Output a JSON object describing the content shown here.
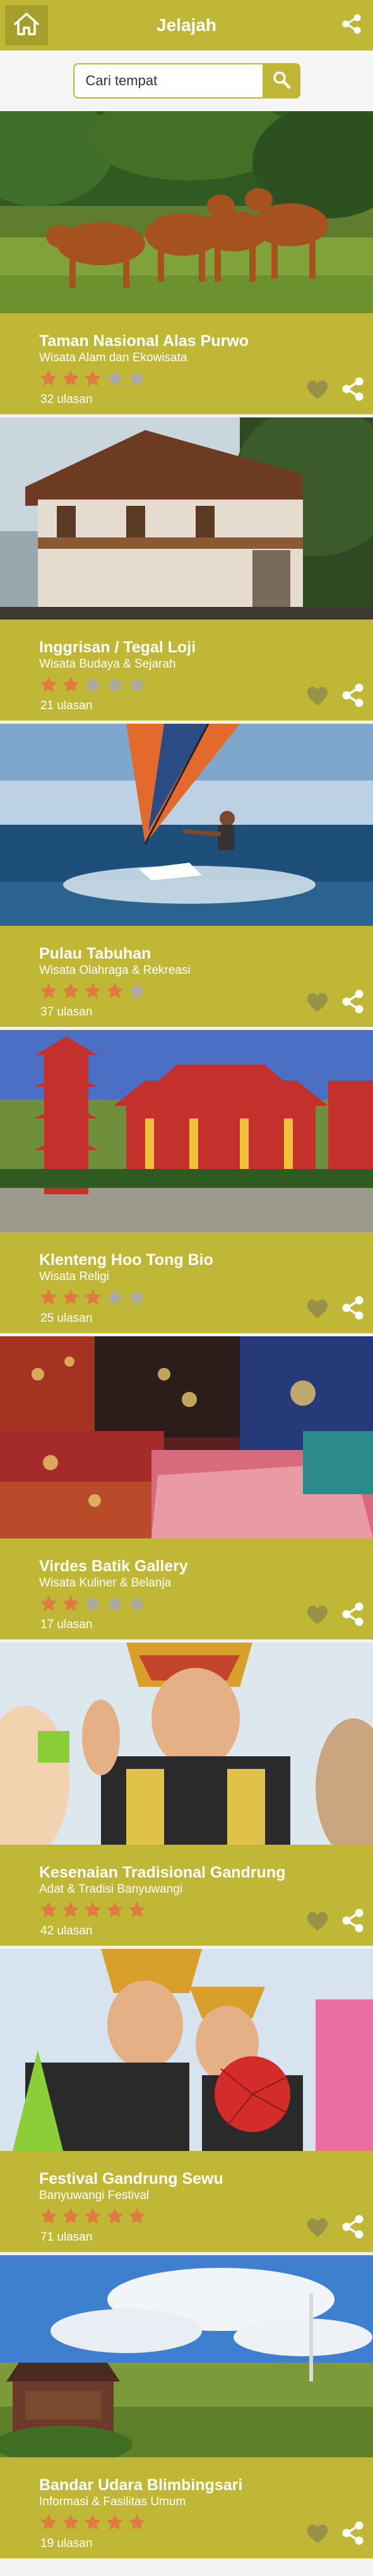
{
  "header": {
    "title": "Jelajah"
  },
  "search": {
    "placeholder": "Cari tempat"
  },
  "colors": {
    "accent": "#c1b736",
    "star_on": "#e07a3f",
    "star_off": "#a9a9a9",
    "icon": "#ffffff"
  },
  "places": [
    {
      "title": "Taman Nasional Alas Purwo",
      "category": "Wisata Alam dan Ekowisata",
      "rating": 3,
      "reviews": "32 ulasan",
      "image": "banteng-photo"
    },
    {
      "title": "Inggrisan / Tegal Loji",
      "category": "Wisata Budaya & Sejarah",
      "rating": 2,
      "reviews": "21 ulasan",
      "image": "colonial-house-photo"
    },
    {
      "title": "Pulau Tabuhan",
      "category": "Wisata Olahraga & Rekreasi",
      "rating": 4,
      "reviews": "37 ulasan",
      "image": "windsurf-photo"
    },
    {
      "title": "Klenteng Hoo Tong Bio",
      "category": "Wisata Religi",
      "rating": 3,
      "reviews": "25 ulasan",
      "image": "temple-photo"
    },
    {
      "title": "Virdes Batik Gallery",
      "category": "Wisata Kuliner & Belanja",
      "rating": 2,
      "reviews": "17 ulasan",
      "image": "batik-photo"
    },
    {
      "title": "Kesenaian Tradisional Gandrung",
      "category": "Adat & Tradisi Banyuwangi",
      "rating": 5,
      "reviews": "42 ulasan",
      "image": "gandrung-dancer-photo"
    },
    {
      "title": "Festival Gandrung Sewu",
      "category": "Banyuwangi Festival",
      "rating": 5,
      "reviews": "71 ulasan",
      "image": "gandrung-festival-photo"
    },
    {
      "title": "Bandar Udara Blimbingsari",
      "category": "Informasi & Fasilitas Umum",
      "rating": 5,
      "reviews": "19 ulasan",
      "image": "airport-photo"
    }
  ]
}
